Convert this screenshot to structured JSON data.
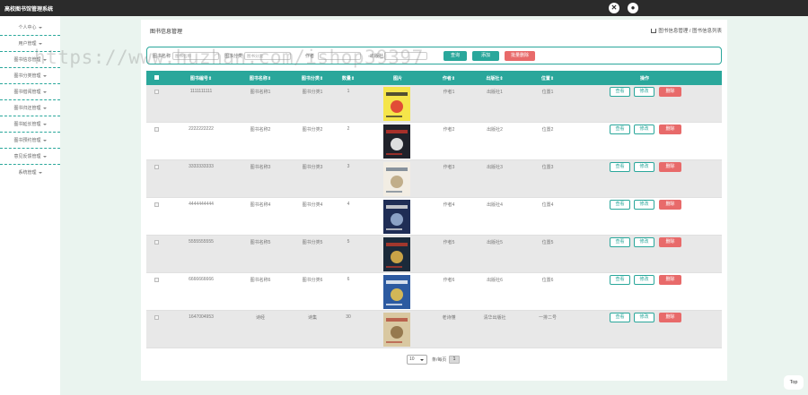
{
  "app": {
    "title": "高校图书馆管理系统"
  },
  "sidebar": {
    "items": [
      {
        "label": "个人中心"
      },
      {
        "label": "用户管理"
      },
      {
        "label": "图书信息管理"
      },
      {
        "label": "图书分类管理"
      },
      {
        "label": "图书借阅管理"
      },
      {
        "label": "图书归还管理"
      },
      {
        "label": "图书延长管理"
      },
      {
        "label": "图书预约管理"
      },
      {
        "label": "意见反馈管理"
      },
      {
        "label": "系统管理"
      }
    ]
  },
  "page": {
    "title": "图书信息管理",
    "breadcrumb": "图书信息管理 / 图书信息列表"
  },
  "search": {
    "field1_label": "图书名称",
    "field1_placeholder": "图书名称",
    "field2_label": "图书分类",
    "field2_placeholder": "图书分类",
    "field3_label": "作者",
    "field4_label": "出版社",
    "query_label": "查询",
    "add_label": "添加",
    "batch_delete_label": "批量删除"
  },
  "table": {
    "headers": [
      "图书编号",
      "图书名称",
      "图书分类",
      "数量",
      "图片",
      "作者",
      "出版社",
      "位置",
      "操作"
    ],
    "rows": [
      {
        "code": "1111111111",
        "name": "图书名称1",
        "category": "图书分类1",
        "qty": "1",
        "author": "作者1",
        "publisher": "出版社1",
        "location": "位置1"
      },
      {
        "code": "2222222222",
        "name": "图书名称2",
        "category": "图书分类2",
        "qty": "2",
        "author": "作者2",
        "publisher": "出版社2",
        "location": "位置2"
      },
      {
        "code": "3333333333",
        "name": "图书名称3",
        "category": "图书分类3",
        "qty": "3",
        "author": "作者3",
        "publisher": "出版社3",
        "location": "位置3"
      },
      {
        "code": "4444444444",
        "name": "图书名称4",
        "category": "图书分类4",
        "qty": "4",
        "author": "作者4",
        "publisher": "出版社4",
        "location": "位置4"
      },
      {
        "code": "5555555555",
        "name": "图书名称5",
        "category": "图书分类5",
        "qty": "5",
        "author": "作者5",
        "publisher": "出版社5",
        "location": "位置5"
      },
      {
        "code": "6666666666",
        "name": "图书名称6",
        "category": "图书分类6",
        "qty": "6",
        "author": "作者6",
        "publisher": "出版社6",
        "location": "位置6"
      },
      {
        "code": "1647004953",
        "name": "诗经",
        "category": "诗集",
        "qty": "30",
        "author": "老诗懂",
        "publisher": "清华出版社",
        "location": "一排二号"
      }
    ],
    "actions": {
      "view": "查看",
      "edit": "修改",
      "delete": "删除"
    }
  },
  "pager": {
    "page_size": "10",
    "per_page_label": "条/每页",
    "current_page": "1"
  },
  "top_button": "Top",
  "watermark": "https://www.huzhan.com/ishop39397",
  "colors": {
    "topbar": "#2b2b2b",
    "accent": "#2aa79b",
    "danger": "#e86a6a",
    "background": "#eaf4ef"
  }
}
